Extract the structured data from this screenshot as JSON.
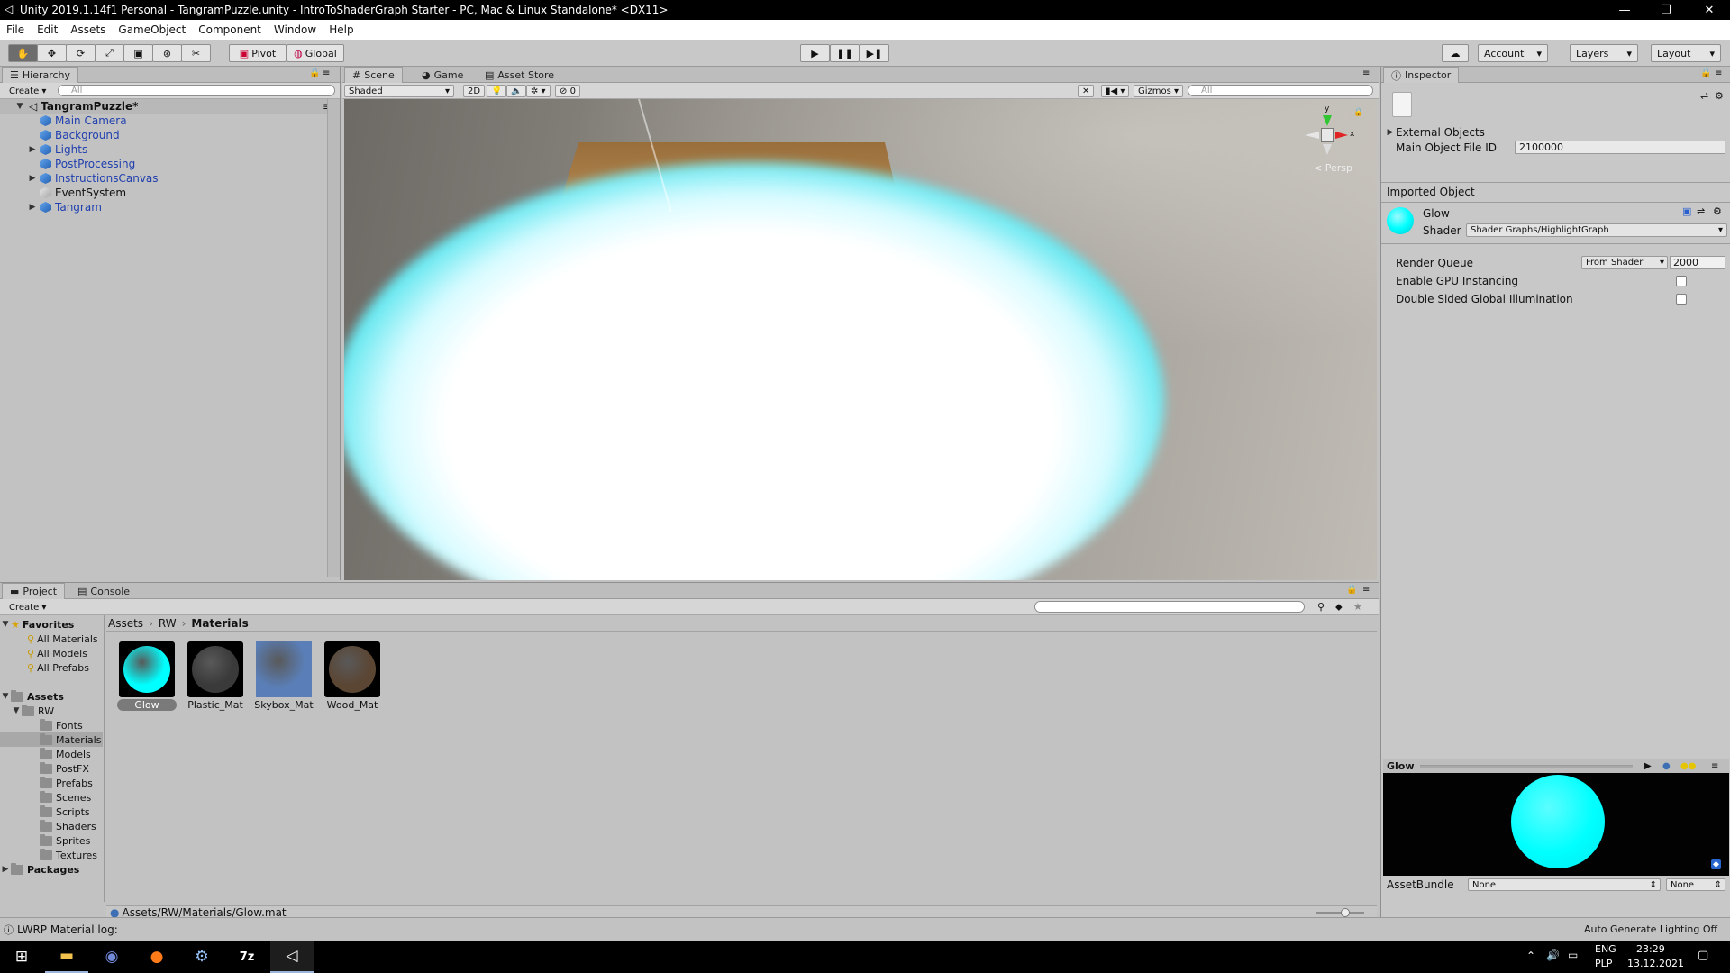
{
  "window": {
    "title": "Unity 2019.1.14f1 Personal - TangramPuzzle.unity - IntroToShaderGraph Starter - PC, Mac & Linux Standalone* <DX11>",
    "minimize": "—",
    "restore": "❐",
    "close": "✕"
  },
  "menu": [
    "File",
    "Edit",
    "Assets",
    "GameObject",
    "Component",
    "Window",
    "Help"
  ],
  "toolbar": {
    "pivot": "Pivot",
    "global": "Global",
    "account": "Account",
    "layers": "Layers",
    "layout": "Layout",
    "tools": [
      "hand-icon",
      "move-icon",
      "rotate-icon",
      "scale-icon",
      "rect-icon",
      "transform-icon",
      "custom-tool-icon"
    ]
  },
  "hierarchy": {
    "tab": "Hierarchy",
    "create": "Create",
    "search_placeholder": "All",
    "scene": "TangramPuzzle*",
    "items": [
      "Main Camera",
      "Background",
      "Lights",
      "PostProcessing",
      "InstructionsCanvas",
      "EventSystem",
      "Tangram"
    ]
  },
  "scene": {
    "tabs": [
      "Scene",
      "Game",
      "Asset Store"
    ],
    "shading": "Shaded",
    "mode_2d": "2D",
    "gizmos": "Gizmos",
    "search_placeholder": "All",
    "fx_count": "0",
    "persp": "Persp",
    "axis_y": "y",
    "axis_x": "x"
  },
  "project": {
    "tabs": [
      "Project",
      "Console"
    ],
    "create": "Create",
    "favorites_label": "Favorites",
    "favorites": [
      "All Materials",
      "All Models",
      "All Prefabs"
    ],
    "assets_label": "Assets",
    "rw_label": "RW",
    "folders": [
      "Fonts",
      "Materials",
      "Models",
      "PostFX",
      "Prefabs",
      "Scenes",
      "Scripts",
      "Shaders",
      "Sprites",
      "Textures"
    ],
    "packages_label": "Packages",
    "breadcrumb": [
      "Assets",
      "RW",
      "Materials"
    ],
    "assets": [
      {
        "name": "Glow",
        "color": "#00ffff"
      },
      {
        "name": "Plastic_Mat",
        "color": "#3a3a3a"
      },
      {
        "name": "Skybox_Mat",
        "color": "#5a7fb8"
      },
      {
        "name": "Wood_Mat",
        "color": "#5b4634"
      }
    ],
    "selected_path": "Assets/RW/Materials/Glow.mat"
  },
  "inspector": {
    "tab": "Inspector",
    "external_objects": "External Objects",
    "main_object_label": "Main Object File ID",
    "main_object_value": "2100000",
    "imported_object": "Imported Object",
    "material_name": "Glow",
    "shader_label": "Shader",
    "shader_value": "Shader Graphs/HighlightGraph",
    "render_queue_label": "Render Queue",
    "render_queue_mode": "From Shader",
    "render_queue_value": "2000",
    "gpu_instancing": "Enable GPU Instancing",
    "gpu_instancing_checked": false,
    "double_sided_gi": "Double Sided Global Illumination",
    "double_sided_gi_checked": false,
    "preview_title": "Glow",
    "preview_color": "#00ffff",
    "assetbundle_label": "AssetBundle",
    "assetbundle_value": "None",
    "assetbundle_variant": "None"
  },
  "status": {
    "log": "LWRP Material log:",
    "lighting": "Auto Generate Lighting Off"
  },
  "taskbar": {
    "apps": [
      "windows-start-icon",
      "file-explorer-icon",
      "discord-icon",
      "firefox-icon",
      "steam-icon",
      "7zip-icon",
      "unity-icon"
    ],
    "lang_top": "ENG",
    "lang_bottom": "PLP",
    "time": "23:29",
    "date": "13.12.2021"
  }
}
